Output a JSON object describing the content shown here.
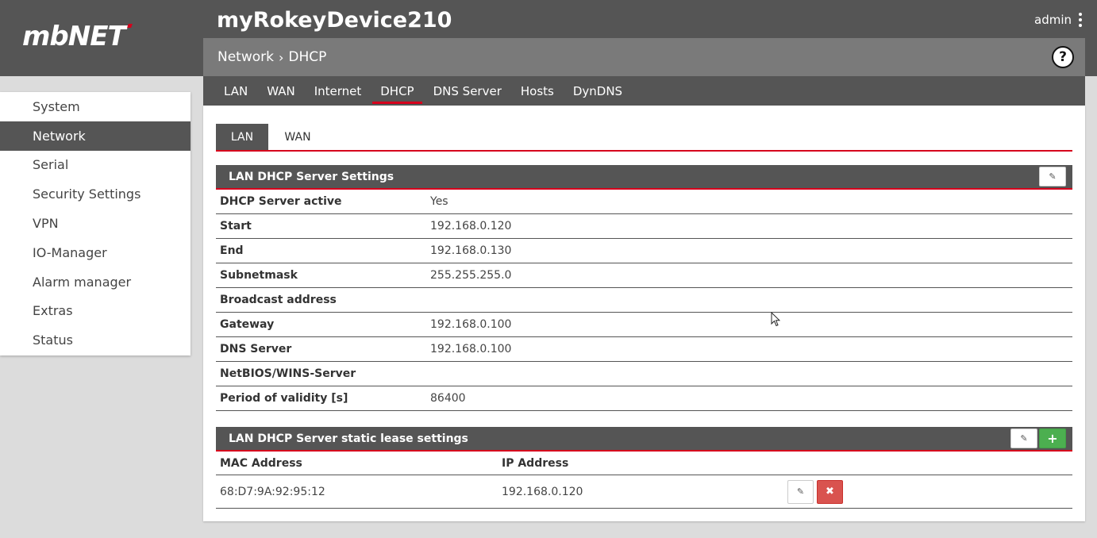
{
  "brand": {
    "logo_text": "mbNET"
  },
  "device": {
    "title": "myRokeyDevice210"
  },
  "user": {
    "name": "admin"
  },
  "breadcrumb": {
    "parent": "Network",
    "separator": "›",
    "current": "DHCP",
    "help": "?"
  },
  "main_tabs": [
    {
      "label": "LAN",
      "active": false
    },
    {
      "label": "WAN",
      "active": false
    },
    {
      "label": "Internet",
      "active": false
    },
    {
      "label": "DHCP",
      "active": true
    },
    {
      "label": "DNS Server",
      "active": false
    },
    {
      "label": "Hosts",
      "active": false
    },
    {
      "label": "DynDNS",
      "active": false
    }
  ],
  "sidebar": {
    "items": [
      {
        "label": "System",
        "active": false
      },
      {
        "label": "Network",
        "active": true
      },
      {
        "label": "Serial",
        "active": false
      },
      {
        "label": "Security Settings",
        "active": false
      },
      {
        "label": "VPN",
        "active": false
      },
      {
        "label": "IO-Manager",
        "active": false
      },
      {
        "label": "Alarm manager",
        "active": false
      },
      {
        "label": "Extras",
        "active": false
      },
      {
        "label": "Status",
        "active": false
      }
    ]
  },
  "sub_tabs": [
    {
      "label": "LAN",
      "active": true
    },
    {
      "label": "WAN",
      "active": false
    }
  ],
  "settings": {
    "title": "LAN DHCP Server Settings",
    "rows": [
      {
        "key": "DHCP Server active",
        "value": "Yes"
      },
      {
        "key": "Start",
        "value": "192.168.0.120"
      },
      {
        "key": "End",
        "value": "192.168.0.130"
      },
      {
        "key": "Subnetmask",
        "value": "255.255.255.0"
      },
      {
        "key": "Broadcast address",
        "value": ""
      },
      {
        "key": "Gateway",
        "value": "192.168.0.100"
      },
      {
        "key": "DNS Server",
        "value": "192.168.0.100"
      },
      {
        "key": "NetBIOS/WINS-Server",
        "value": ""
      },
      {
        "key": "Period of validity [s]",
        "value": "86400"
      }
    ]
  },
  "leases": {
    "title": "LAN DHCP Server static lease settings",
    "columns": {
      "mac": "MAC Address",
      "ip": "IP Address"
    },
    "rows": [
      {
        "mac": "68:D7:9A:92:95:12",
        "ip": "192.168.0.120"
      }
    ],
    "add_label": "+",
    "delete_label": "✖"
  },
  "colors": {
    "dark": "#555555",
    "breadcrumb_bg": "#7a7a7a",
    "accent_red": "#d6001c",
    "add_green": "#4caf50",
    "delete_red": "#d9534f",
    "page_bg": "#dcdcdc"
  }
}
